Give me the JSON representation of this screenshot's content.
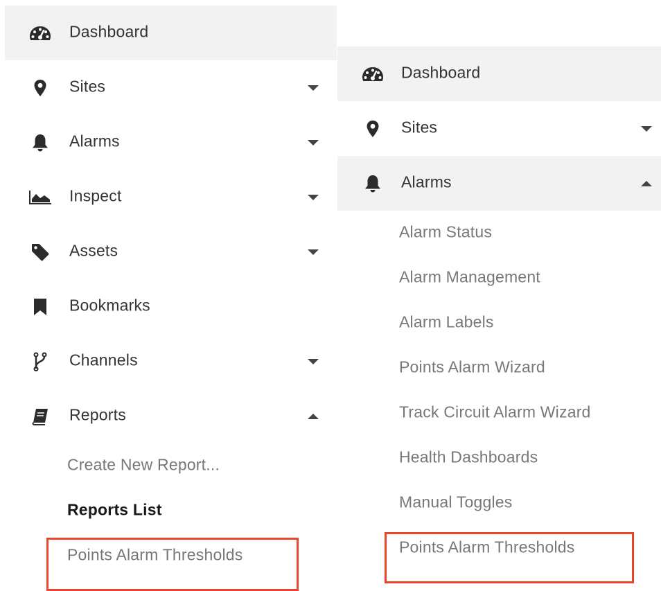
{
  "left_menu": {
    "items": [
      {
        "label": "Dashboard",
        "icon": "dashboard-icon",
        "active": true,
        "caret": "none"
      },
      {
        "label": "Sites",
        "icon": "map-marker-icon",
        "active": false,
        "caret": "down"
      },
      {
        "label": "Alarms",
        "icon": "bell-icon",
        "active": false,
        "caret": "down"
      },
      {
        "label": "Inspect",
        "icon": "area-chart-icon",
        "active": false,
        "caret": "down"
      },
      {
        "label": "Assets",
        "icon": "tag-icon",
        "active": false,
        "caret": "down"
      },
      {
        "label": "Bookmarks",
        "icon": "bookmark-icon",
        "active": false,
        "caret": "none"
      },
      {
        "label": "Channels",
        "icon": "branch-icon",
        "active": false,
        "caret": "down"
      },
      {
        "label": "Reports",
        "icon": "book-icon",
        "active": false,
        "caret": "up"
      }
    ],
    "subitems": [
      {
        "label": "Create New Report..."
      },
      {
        "label": "Reports List"
      },
      {
        "label": "Points Alarm Thresholds"
      }
    ]
  },
  "right_menu": {
    "items": [
      {
        "label": "Dashboard",
        "icon": "dashboard-icon",
        "active": true,
        "caret": "none"
      },
      {
        "label": "Sites",
        "icon": "map-marker-icon",
        "active": false,
        "caret": "down"
      },
      {
        "label": "Alarms",
        "icon": "bell-icon",
        "active": true,
        "caret": "up"
      }
    ],
    "subitems": [
      {
        "label": "Alarm Status"
      },
      {
        "label": "Alarm Management"
      },
      {
        "label": "Alarm Labels"
      },
      {
        "label": "Points Alarm Wizard"
      },
      {
        "label": "Track Circuit Alarm Wizard"
      },
      {
        "label": "Health Dashboards"
      },
      {
        "label": "Manual Toggles"
      },
      {
        "label": "Points Alarm Thresholds"
      }
    ]
  },
  "colors": {
    "active_bg": "#f2f2f2",
    "text": "#333333",
    "subtext": "#777777",
    "highlight": "#e8452e"
  }
}
